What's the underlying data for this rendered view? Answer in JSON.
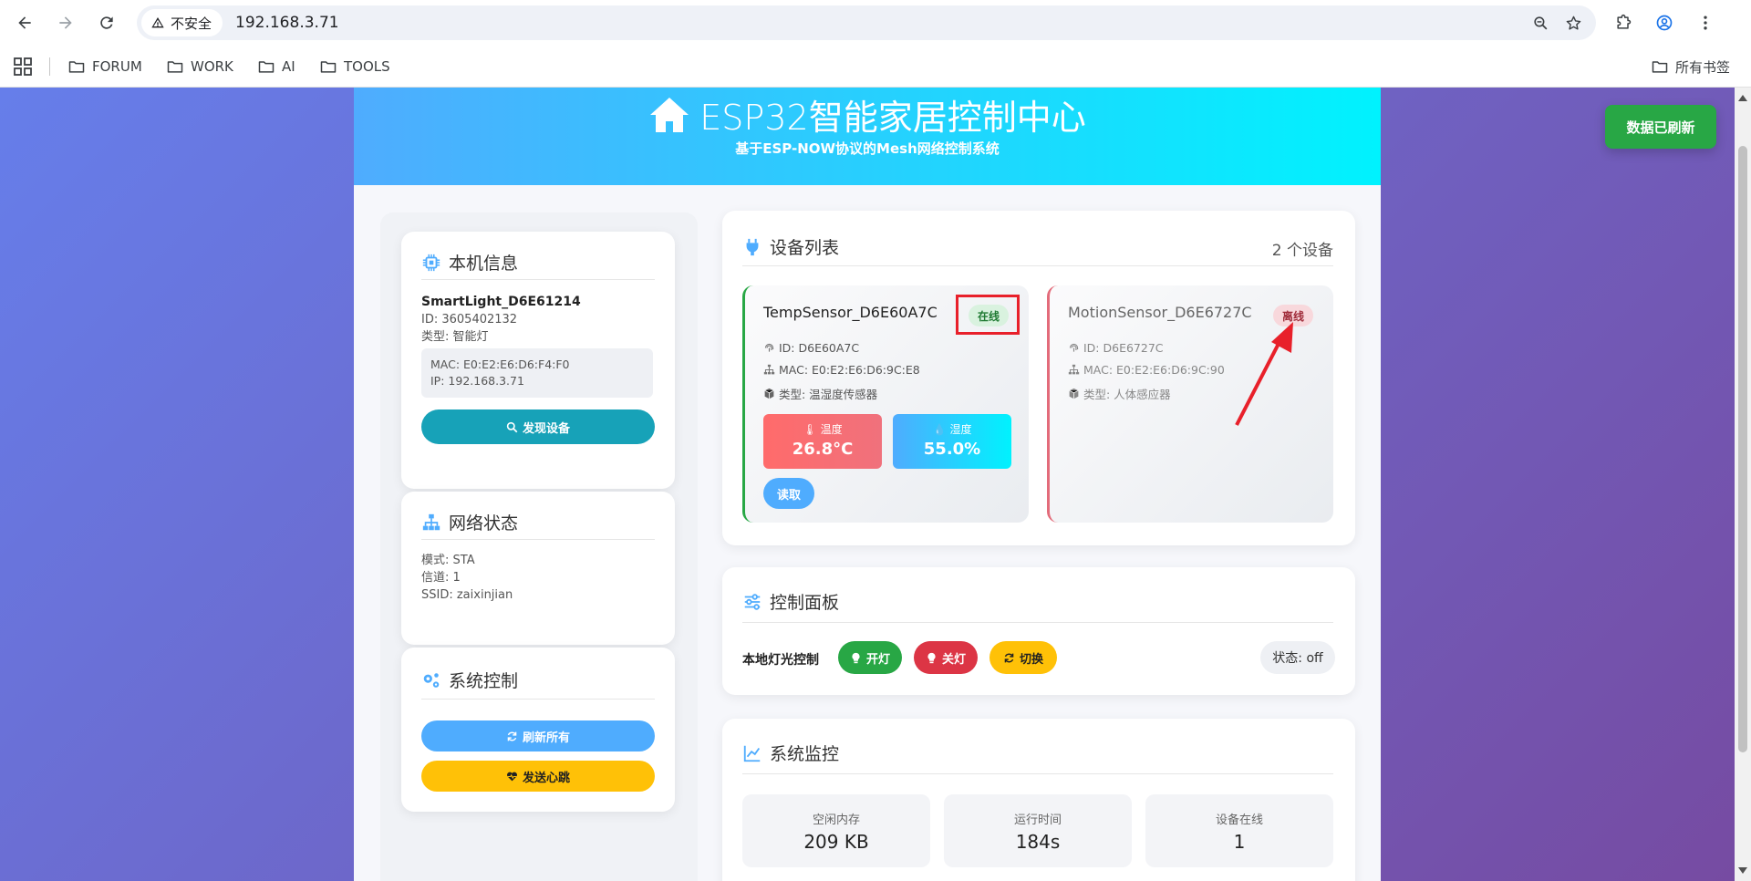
{
  "browser": {
    "security_label": "不安全",
    "url": "192.168.3.71",
    "bookmarks": [
      "FORUM",
      "WORK",
      "AI",
      "TOOLS"
    ],
    "all_bookmarks": "所有书签"
  },
  "header": {
    "title": "ESP32智能家居控制中心",
    "subtitle": "基于ESP-NOW协议的Mesh网络控制系统"
  },
  "toast": "数据已刷新",
  "local_info": {
    "title": "本机信息",
    "name": "SmartLight_D6E61214",
    "id": "ID: 3605402132",
    "type": "类型: 智能灯",
    "mac": "MAC: E0:E2:E6:D6:F4:F0",
    "ip": "IP: 192.168.3.71",
    "discover_button": "发现设备"
  },
  "network": {
    "title": "网络状态",
    "mode": "模式: STA",
    "channel": "信道: 1",
    "ssid": "SSID: zaixinjian"
  },
  "system_control": {
    "title": "系统控制",
    "refresh_button": "刷新所有",
    "heartbeat_button": "发送心跳"
  },
  "device_list": {
    "title": "设备列表",
    "count": "2 个设备",
    "devices": [
      {
        "name": "TempSensor_D6E60A7C",
        "status": "在线",
        "id": "ID: D6E60A7C",
        "mac": "MAC: E0:E2:E6:D6:9C:E8",
        "type": "类型: 温湿度传感器",
        "temp_label": "温度",
        "temp_value": "26.8°C",
        "hum_label": "湿度",
        "hum_value": "55.0%",
        "read_button": "读取"
      },
      {
        "name": "MotionSensor_D6E6727C",
        "status": "离线",
        "id": "ID: D6E6727C",
        "mac": "MAC: E0:E2:E6:D6:9C:90",
        "type": "类型: 人体感应器"
      }
    ]
  },
  "control_panel": {
    "title": "控制面板",
    "label": "本地灯光控制",
    "on_button": "开灯",
    "off_button": "关灯",
    "toggle_button": "切换",
    "state": "状态: off"
  },
  "monitor": {
    "title": "系统监控",
    "stats": [
      {
        "label": "空闲内存",
        "value": "209 KB"
      },
      {
        "label": "运行时间",
        "value": "184s"
      },
      {
        "label": "设备在线",
        "value": "1"
      }
    ]
  },
  "colors": {
    "online_border": "#28a745",
    "offline_border": "#e36b7a",
    "annotation": "#e8202a"
  }
}
